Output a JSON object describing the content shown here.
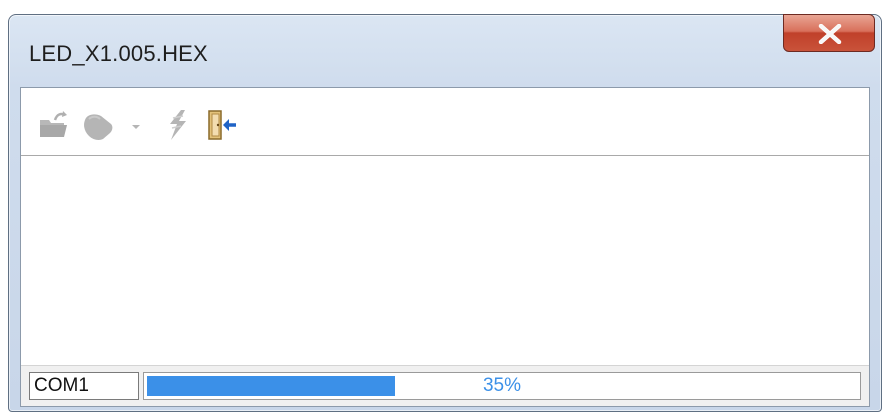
{
  "window": {
    "title": "LED_X1.005.HEX"
  },
  "toolbar": {
    "items": [
      {
        "icon": "open-folder-icon",
        "enabled": false
      },
      {
        "icon": "chip-icon",
        "enabled": false
      },
      {
        "icon": "dropdown-arrow-icon",
        "enabled": false
      },
      {
        "icon": "lightning-icon",
        "enabled": false
      },
      {
        "icon": "exit-door-icon",
        "enabled": true
      }
    ]
  },
  "status": {
    "port": "COM1",
    "progress_label": "35%",
    "progress_fraction": 0.35
  },
  "colors": {
    "progress": "#3b90e8",
    "close_button": "#c9533a",
    "disabled_icon": "#b5b5b5"
  }
}
